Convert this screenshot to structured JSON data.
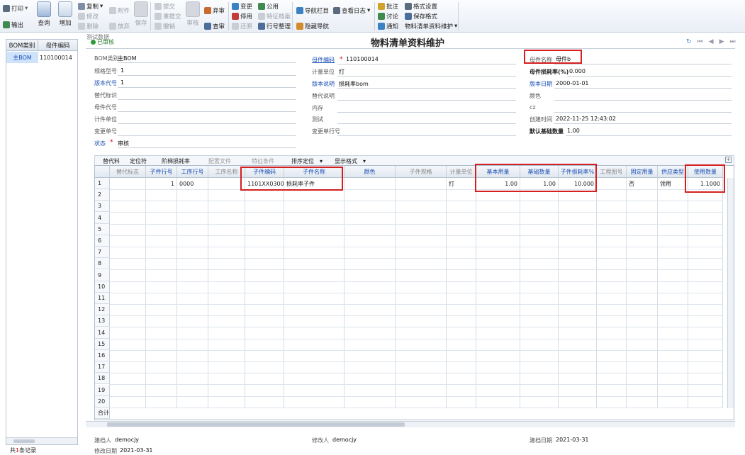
{
  "toolbar": {
    "print": "打印",
    "export": "输出",
    "query": "查询",
    "add": "增加",
    "copy": "复制",
    "modify": "修改",
    "delete": "删除",
    "attachment": "附件",
    "abandon": "放弃",
    "save": "保存",
    "submit": "提交",
    "resubmit": "重提交",
    "withdraw": "撤销",
    "audit": "审核",
    "abandon_audit": "弃审",
    "check_audit": "查审",
    "change": "变更",
    "disable": "停用",
    "restore": "还原",
    "public": "公用",
    "feature_file": "特征档案",
    "row_arrange": "行号整理",
    "nav_bar": "导航栏目",
    "view_log": "查看日志",
    "hide_nav": "隐藏导航",
    "annotate": "批注",
    "discuss": "讨论",
    "notify": "通知",
    "format_setting": "格式设置",
    "save_format": "保存格式",
    "format_name": "物料清单资料维护"
  },
  "ghost_tab": "测试数据",
  "status_tag": "已审核",
  "title": "物料清单资料维护",
  "left_panel": {
    "headers": [
      "BOM类别",
      "母件编码"
    ],
    "row": [
      "主BOM",
      "110100014"
    ],
    "footer_prefix": "共",
    "footer_count": "1",
    "footer_suffix": "条记录"
  },
  "form": {
    "bom_type_label": "BOM类别",
    "bom_type": "主BOM",
    "spec_label": "规格型号",
    "spec": "1",
    "version_code_label": "版本代号",
    "version_code": "1",
    "alt_label": "替代标识",
    "parent_code2_label": "母件代号",
    "piece_unit_label": "计件单位",
    "change_no_label": "变更单号",
    "status_label": "状态",
    "status": "审核",
    "parent_code_label": "母件编码",
    "parent_code": "110100014",
    "unit_label": "计量单位",
    "unit": "打",
    "version_desc_label": "版本说明",
    "version_desc": "损耗率bom",
    "alt_desc_label": "替代说明",
    "memory_label": "内存",
    "test_label": "测试",
    "change_row_label": "变更单行号",
    "parent_name_label": "母件名称",
    "parent_name": "母件b",
    "loss_rate_label": "母件损耗率(%)",
    "loss_rate": "0.000",
    "version_date_label": "版本日期",
    "version_date": "2000-01-01",
    "color_label": "颜色",
    "cz_label": "cz",
    "create_time_label": "创建时间",
    "create_time": "2022-11-25 12:43:02",
    "default_qty_label": "默认基础数量",
    "default_qty": "1.00"
  },
  "grid_toolbar": {
    "alt": "替代料",
    "locate": "定位符",
    "ladder": "阶梯损耗率",
    "config": "配置文件",
    "feature": "特征条件",
    "sort": "排序定位",
    "display": "显示格式"
  },
  "grid": {
    "headers": [
      "替代标志",
      "子件行号",
      "工序行号",
      "工序名称",
      "子件编码",
      "子件名称",
      "颜色",
      "子件规格",
      "计量单位",
      "基本用量",
      "基础数量",
      "子件损耗率%",
      "工程图号",
      "固定用量",
      "供应类型",
      "使用数量"
    ],
    "row1": [
      "",
      "1",
      "0000",
      "",
      "1101XX03002",
      "损耗率子件",
      "",
      "",
      "打",
      "1.00",
      "1.00",
      "10.000",
      "",
      "否",
      "领用",
      "1.1000"
    ],
    "row_numbers": [
      "1",
      "2",
      "3",
      "4",
      "5",
      "6",
      "7",
      "8",
      "9",
      "10",
      "11",
      "12",
      "13",
      "14",
      "15",
      "16",
      "17",
      "18",
      "19",
      "20"
    ],
    "total_label": "合计"
  },
  "footer": {
    "creator_label": "建档人",
    "creator": "democjy",
    "modifier_label": "修改人",
    "modifier": "democjy",
    "create_date_label": "建档日期",
    "create_date": "2021-03-31",
    "modify_date_label": "修改日期",
    "modify_date": "2021-03-31"
  },
  "colors": {
    "accent": "#1a4fb4",
    "highlight": "#d42020",
    "selected_row": "#cfe3fb"
  }
}
